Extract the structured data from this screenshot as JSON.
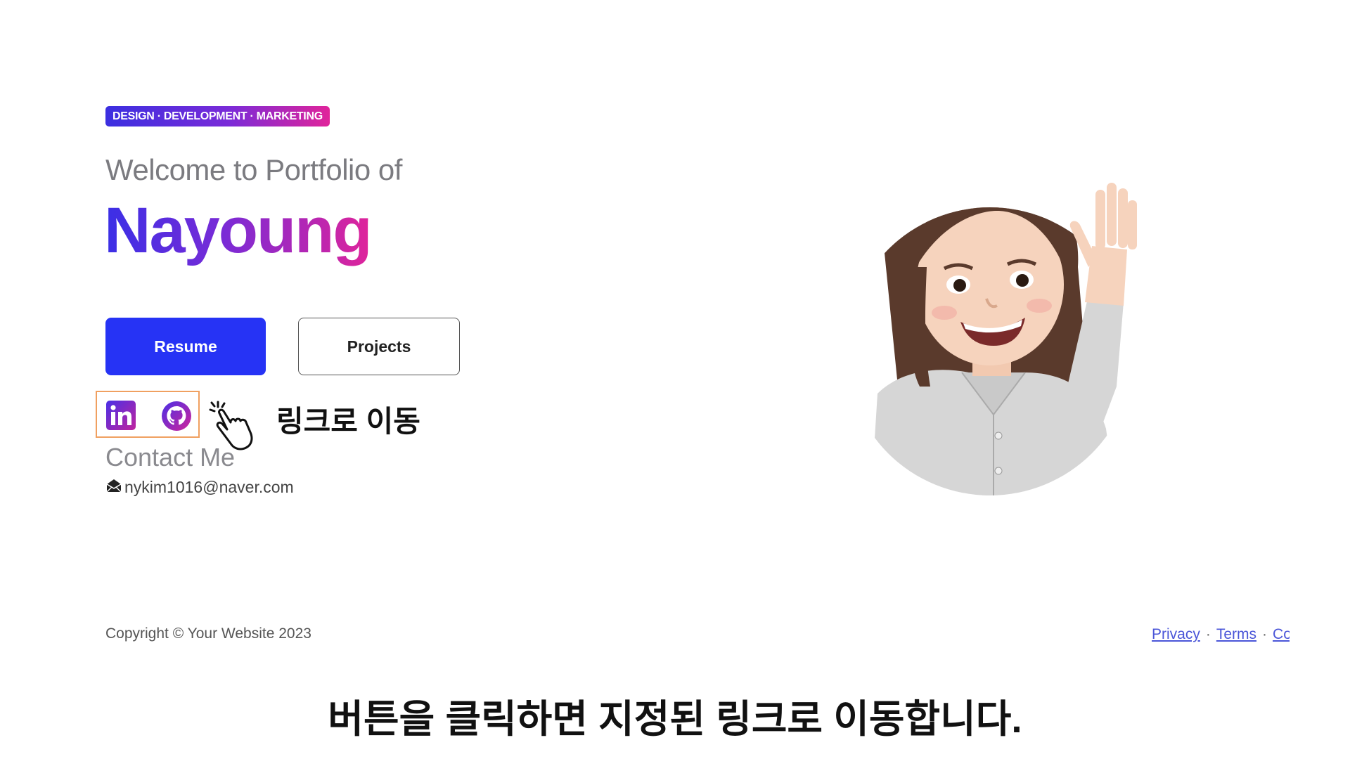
{
  "hero": {
    "badge": "DESIGN · DEVELOPMENT · MARKETING",
    "welcome": "Welcome to Portfolio of",
    "name": "Nayoung"
  },
  "buttons": {
    "resume": "Resume",
    "projects": "Projects"
  },
  "social": {
    "icons": [
      "linkedin-icon",
      "github-icon"
    ],
    "highlight_color": "#f0a060"
  },
  "annotation": {
    "label": "링크로 이동"
  },
  "contact": {
    "title": "Contact Me",
    "email": "nykim1016@naver.com"
  },
  "footer": {
    "copyright": "Copyright © Your Website 2023",
    "links": [
      "Privacy",
      "Terms",
      "Contact"
    ]
  },
  "caption": "버튼을 클릭하면 지정된 링크로 이동합니다.",
  "colors": {
    "primary_button": "#2633f5",
    "gradient_start": "#3a2fe6",
    "gradient_mid": "#7a2bd6",
    "gradient_end": "#e0249a",
    "link": "#4a55d8"
  }
}
